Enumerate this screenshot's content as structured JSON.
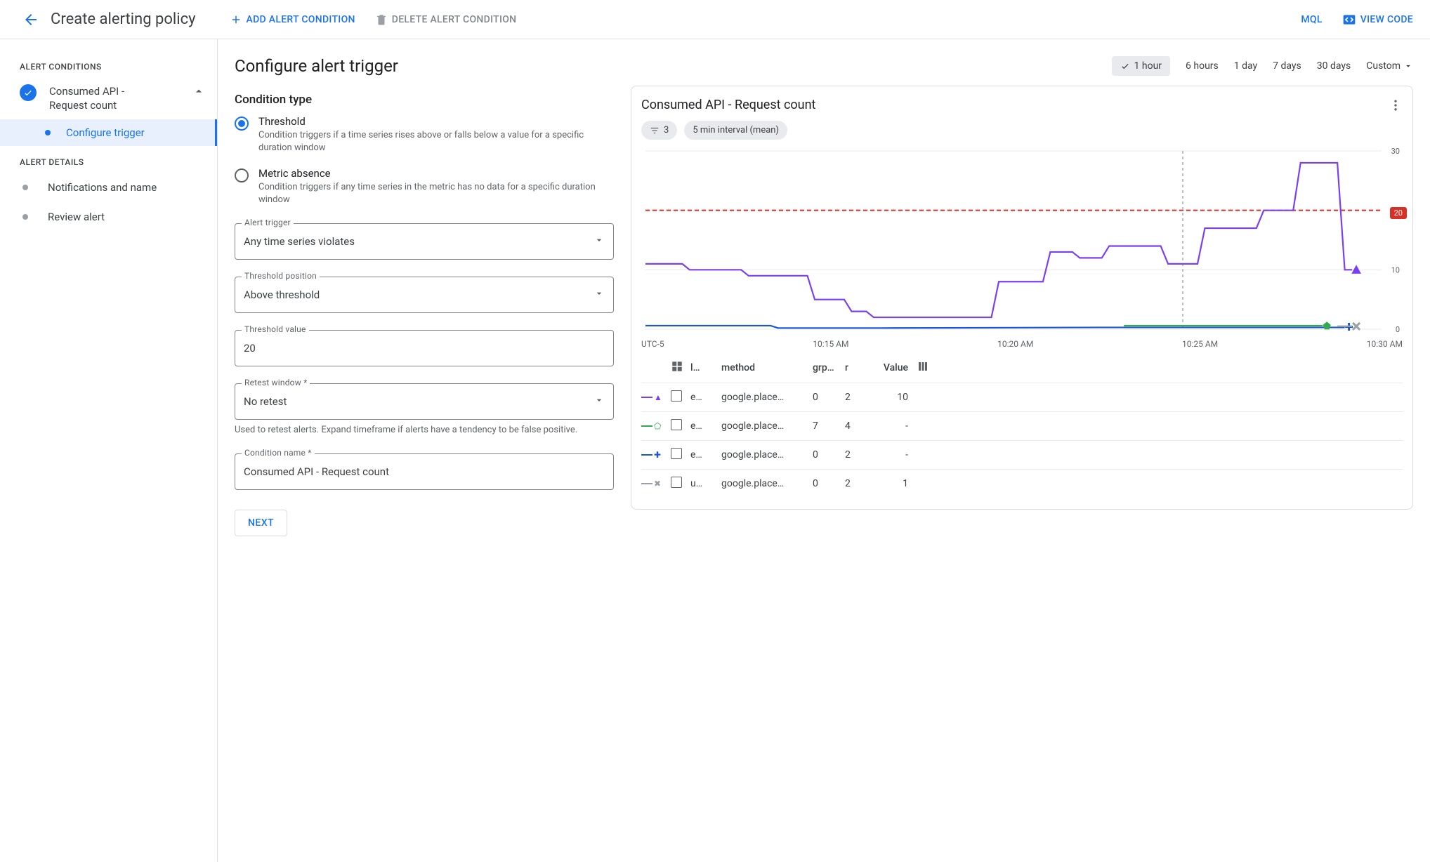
{
  "header": {
    "title": "Create alerting policy",
    "add_condition": "ADD ALERT CONDITION",
    "delete_condition": "DELETE ALERT CONDITION",
    "mql": "MQL",
    "view_code": "VIEW CODE"
  },
  "sidebar": {
    "sections": {
      "conditions_label": "ALERT CONDITIONS",
      "details_label": "ALERT DETAILS"
    },
    "condition_name": "Consumed API - Request count",
    "substep_configure": "Configure trigger",
    "notifications": "Notifications and name",
    "review": "Review alert"
  },
  "form": {
    "heading": "Configure alert trigger",
    "condition_type_label": "Condition type",
    "threshold": {
      "title": "Threshold",
      "desc": "Condition triggers if a time series rises above or falls below a value for a specific duration window"
    },
    "absence": {
      "title": "Metric absence",
      "desc": "Condition triggers if any time series in the metric has no data for a specific duration window"
    },
    "alert_trigger": {
      "label": "Alert trigger",
      "value": "Any time series violates"
    },
    "threshold_position": {
      "label": "Threshold position",
      "value": "Above threshold"
    },
    "threshold_value": {
      "label": "Threshold value",
      "value": "20"
    },
    "retest": {
      "label": "Retest window *",
      "value": "No retest",
      "helper": "Used to retest alerts. Expand timeframe if alerts have a tendency to be false positive."
    },
    "condition_name": {
      "label": "Condition name *",
      "value": "Consumed API - Request count"
    },
    "next": "NEXT"
  },
  "ranges": {
    "options": [
      "1 hour",
      "6 hours",
      "1 day",
      "7 days",
      "30 days"
    ],
    "custom": "Custom",
    "active_index": 0
  },
  "card": {
    "title": "Consumed API - Request count",
    "filter_chip_count": "3",
    "interval_chip": "5 min interval (mean)",
    "threshold_badge": "20",
    "tz_label": "UTC-5"
  },
  "chart_data": {
    "type": "line",
    "ylim": [
      0,
      30
    ],
    "threshold": 20,
    "y_ticks": [
      0,
      10,
      20,
      30
    ],
    "x_ticks": [
      "10:15 AM",
      "10:20 AM",
      "10:25 AM",
      "10:30 AM"
    ],
    "cursor_x": 0.73,
    "series": [
      {
        "name": "purple",
        "color": "#7b3ff2",
        "symbol": "triangle",
        "points": [
          [
            0.0,
            11
          ],
          [
            0.05,
            11
          ],
          [
            0.06,
            10
          ],
          [
            0.13,
            10
          ],
          [
            0.14,
            9
          ],
          [
            0.22,
            9
          ],
          [
            0.23,
            5
          ],
          [
            0.27,
            5
          ],
          [
            0.28,
            3
          ],
          [
            0.3,
            3
          ],
          [
            0.31,
            2
          ],
          [
            0.47,
            2
          ],
          [
            0.48,
            8
          ],
          [
            0.54,
            8
          ],
          [
            0.55,
            13
          ],
          [
            0.58,
            13
          ],
          [
            0.59,
            12
          ],
          [
            0.62,
            12
          ],
          [
            0.63,
            14
          ],
          [
            0.7,
            14
          ],
          [
            0.71,
            11
          ],
          [
            0.75,
            11
          ],
          [
            0.76,
            17
          ],
          [
            0.83,
            17
          ],
          [
            0.84,
            20
          ],
          [
            0.88,
            20
          ],
          [
            0.89,
            28
          ],
          [
            0.94,
            28
          ],
          [
            0.95,
            10
          ],
          [
            0.96,
            10
          ]
        ]
      },
      {
        "name": "blue",
        "color": "#1a57d8",
        "symbol": "plus",
        "points": [
          [
            0.0,
            0.6
          ],
          [
            0.17,
            0.6
          ],
          [
            0.18,
            0.2
          ],
          [
            0.32,
            0.2
          ],
          [
            0.62,
            0.3
          ],
          [
            0.95,
            0.3
          ]
        ]
      },
      {
        "name": "green",
        "color": "#34a853",
        "symbol": "pentagon",
        "points": [
          [
            0.65,
            0.6
          ],
          [
            0.92,
            0.6
          ]
        ]
      },
      {
        "name": "grey",
        "color": "#9aa0a6",
        "symbol": "x",
        "points": [
          [
            0.94,
            0.5
          ],
          [
            0.96,
            0.5
          ]
        ]
      }
    ]
  },
  "table": {
    "headers": {
      "c1": "l…",
      "c2": "method",
      "c3": "grp…",
      "c4": "r",
      "c5": "Value"
    },
    "rows": [
      {
        "marker": "purple",
        "c1": "e…",
        "method": "google.place…",
        "grp": "0",
        "r": "2",
        "value": "10"
      },
      {
        "marker": "green",
        "c1": "e…",
        "method": "google.place…",
        "grp": "7",
        "r": "4",
        "value": "-"
      },
      {
        "marker": "blue",
        "c1": "e…",
        "method": "google.place…",
        "grp": "0",
        "r": "2",
        "value": "-"
      },
      {
        "marker": "grey",
        "c1": "u…",
        "method": "google.place…",
        "grp": "0",
        "r": "2",
        "value": "1"
      }
    ]
  }
}
